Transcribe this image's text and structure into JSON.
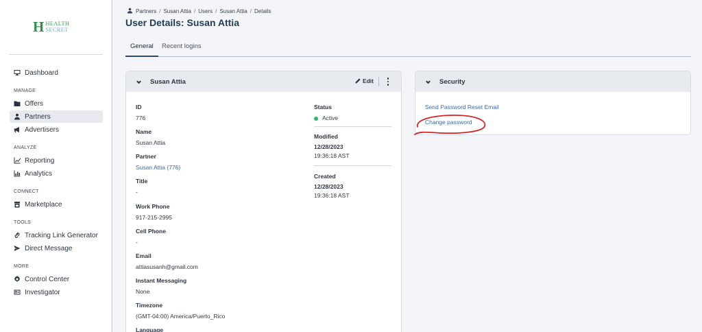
{
  "brand": {
    "logo_letter": "H",
    "logo_line1": "HEALTH",
    "logo_line2": "SECRET"
  },
  "sidebar": {
    "dashboard": "Dashboard",
    "sections": [
      {
        "label": "MANAGE",
        "items": [
          "Offers",
          "Partners",
          "Advertisers"
        ]
      },
      {
        "label": "ANALYZE",
        "items": [
          "Reporting",
          "Analytics"
        ]
      },
      {
        "label": "CONNECT",
        "items": [
          "Marketplace"
        ]
      },
      {
        "label": "TOOLS",
        "items": [
          "Tracking Link Generator",
          "Direct Message"
        ]
      },
      {
        "label": "MORE",
        "items": [
          "Control Center",
          "Investigator"
        ]
      }
    ],
    "active_item": "Partners"
  },
  "breadcrumb": [
    "Partners",
    "Susan Attia",
    "Users",
    "Susan Attia",
    "Details"
  ],
  "page_title": "User Details: Susan Attia",
  "tabs": [
    "General",
    "Recent logins"
  ],
  "user_card": {
    "title": "Susan Attia",
    "edit_label": "Edit",
    "fields": [
      {
        "label": "ID",
        "value": "776"
      },
      {
        "label": "Name",
        "value": "Susan Attia"
      },
      {
        "label": "Partner",
        "value": "Susan Attia (776)"
      },
      {
        "label": "Title",
        "value": "-"
      },
      {
        "label": "Work Phone",
        "value": "917-215-2995"
      },
      {
        "label": "Cell Phone",
        "value": "-"
      },
      {
        "label": "Email",
        "value": "attiasusanh@gmail.com"
      },
      {
        "label": "Instant Messaging",
        "value": "None"
      },
      {
        "label": "Timezone",
        "value": "(GMT-04:00) America/Puerto_Rico"
      },
      {
        "label": "Language",
        "value": ""
      }
    ],
    "status": {
      "label": "Status",
      "value": "Active",
      "color": "#2bb672"
    },
    "modified": {
      "label": "Modified",
      "date": "12/28/2023",
      "time": "19:36:18 AST"
    },
    "created": {
      "label": "Created",
      "date": "12/28/2023",
      "time": "19:36:18 AST"
    }
  },
  "security_card": {
    "title": "Security",
    "links": [
      "Send Password Reset Email",
      "Change password"
    ]
  },
  "colors": {
    "accent": "#1f3b57",
    "link": "#3b6aa8",
    "annotation": "#d42424"
  }
}
